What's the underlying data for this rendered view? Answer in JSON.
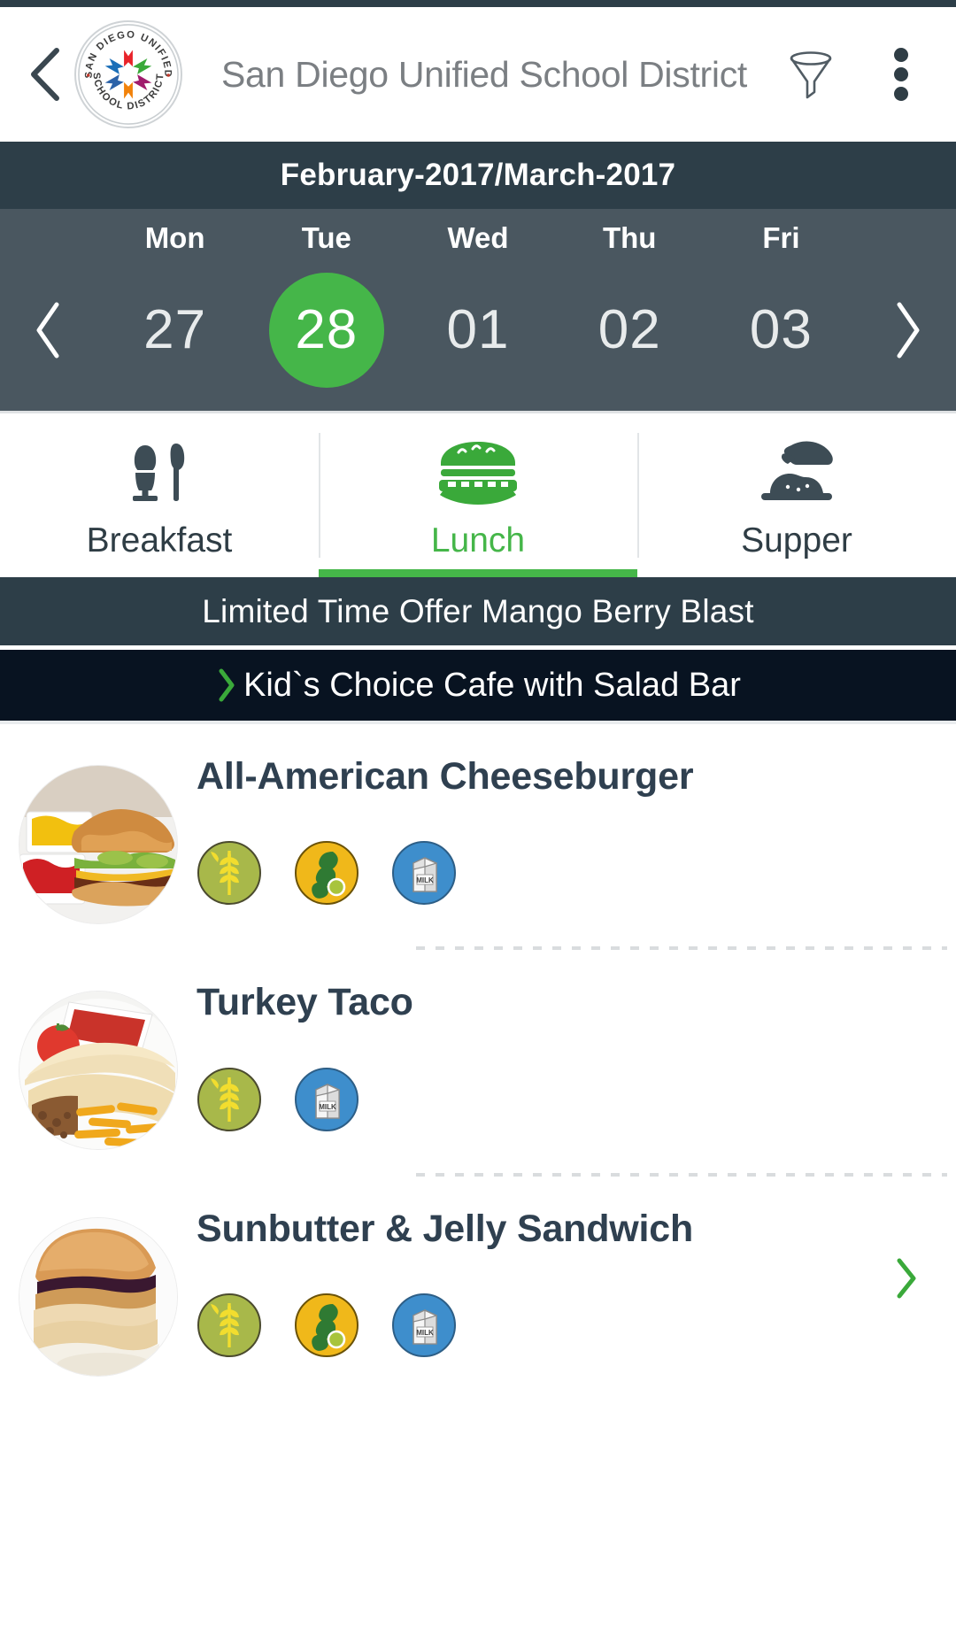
{
  "colors": {
    "brand_green": "#45b649",
    "dark_slate": "#2d3e48",
    "week_slate": "#4a5760",
    "station_navy": "#081321",
    "title_text": "#2f4050",
    "header_text": "#7b7f83"
  },
  "header": {
    "back_icon": "back-chevron-icon",
    "logo": {
      "icon": "school-district-logo",
      "ring_text_top": "SAN DIEGO UNIFIED",
      "ring_text_bottom": "SCHOOL DISTRICT"
    },
    "title": "San Diego Unified School District",
    "filter_icon": "filter-funnel-icon",
    "overflow_icon": "more-vertical-icon"
  },
  "calendar": {
    "month_range": "February-2017/March-2017",
    "prev_icon": "chevron-left-icon",
    "next_icon": "chevron-right-icon",
    "days": [
      {
        "dow": "Mon",
        "date": "27",
        "selected": false
      },
      {
        "dow": "Tue",
        "date": "28",
        "selected": true
      },
      {
        "dow": "Wed",
        "date": "01",
        "selected": false
      },
      {
        "dow": "Thu",
        "date": "02",
        "selected": false
      },
      {
        "dow": "Fri",
        "date": "03",
        "selected": false
      }
    ]
  },
  "meal_tabs": [
    {
      "label": "Breakfast",
      "icon": "egg-cup-spoon-icon",
      "active": false
    },
    {
      "label": "Lunch",
      "icon": "burger-icon",
      "active": true
    },
    {
      "label": "Supper",
      "icon": "cloche-plate-icon",
      "active": false
    }
  ],
  "promo_banner": {
    "text": "Limited Time Offer Mango Berry Blast"
  },
  "station": {
    "chevron_icon": "chevron-right-icon",
    "name": "Kid`s Choice Cafe with Salad Bar"
  },
  "menu_items": [
    {
      "name": "All-American Cheeseburger",
      "thumb_icon": "cheeseburger-photo",
      "arrow_icon": "chevron-right-icon",
      "allergens": [
        {
          "name": "wheat",
          "icon": "wheat-allergen-icon",
          "bg": "#a8b84a"
        },
        {
          "name": "soy",
          "icon": "soy-allergen-icon",
          "bg": "#f0b81a"
        },
        {
          "name": "milk",
          "icon": "milk-allergen-icon",
          "bg": "#3e8ecc"
        }
      ]
    },
    {
      "name": "Turkey Taco",
      "thumb_icon": "turkey-taco-photo",
      "arrow_icon": "chevron-right-icon",
      "allergens": [
        {
          "name": "wheat",
          "icon": "wheat-allergen-icon",
          "bg": "#a8b84a"
        },
        {
          "name": "milk",
          "icon": "milk-allergen-icon",
          "bg": "#3e8ecc"
        }
      ]
    },
    {
      "name": "Sunbutter & Jelly Sandwich",
      "thumb_icon": "sunbutter-jelly-photo",
      "arrow_icon": "chevron-right-icon",
      "allergens": [
        {
          "name": "wheat",
          "icon": "wheat-allergen-icon",
          "bg": "#a8b84a"
        },
        {
          "name": "soy",
          "icon": "soy-allergen-icon",
          "bg": "#f0b81a"
        },
        {
          "name": "milk",
          "icon": "milk-allergen-icon",
          "bg": "#3e8ecc"
        }
      ]
    }
  ]
}
